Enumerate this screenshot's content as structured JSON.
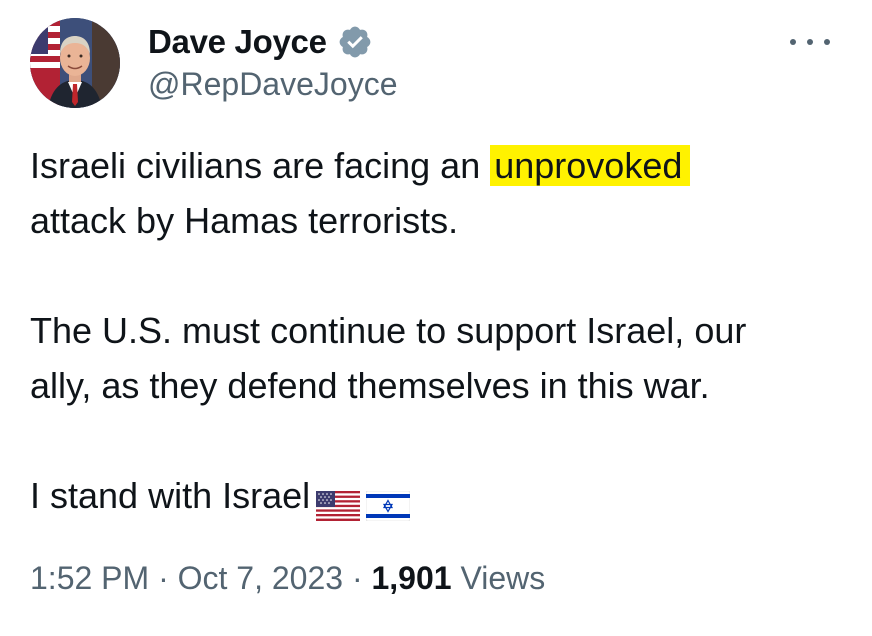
{
  "author": {
    "name": "Dave Joyce",
    "handle": "@RepDaveJoyce",
    "verified_color": "#829aab"
  },
  "tweet": {
    "line1_prefix": "Israeli civilians are facing an ",
    "line1_highlight": "unprovoked",
    "line2": "attack by Hamas terrorists.",
    "line3": "The U.S. must continue to support Israel, our",
    "line4": "ally, as they defend themselves in this war.",
    "line5": "I stand with Israel",
    "highlight_color": "#fff200",
    "emojis": [
      "us-flag-emoji",
      "israel-flag-emoji"
    ]
  },
  "meta": {
    "time": "1:52 PM",
    "separator": "·",
    "date": "Oct 7, 2023",
    "views_count": "1,901",
    "views_label": "Views"
  },
  "icons": {
    "more": "more-options-icon",
    "verified": "verified-badge-icon"
  },
  "colors": {
    "text_primary": "#0f1419",
    "text_secondary": "#536471"
  }
}
